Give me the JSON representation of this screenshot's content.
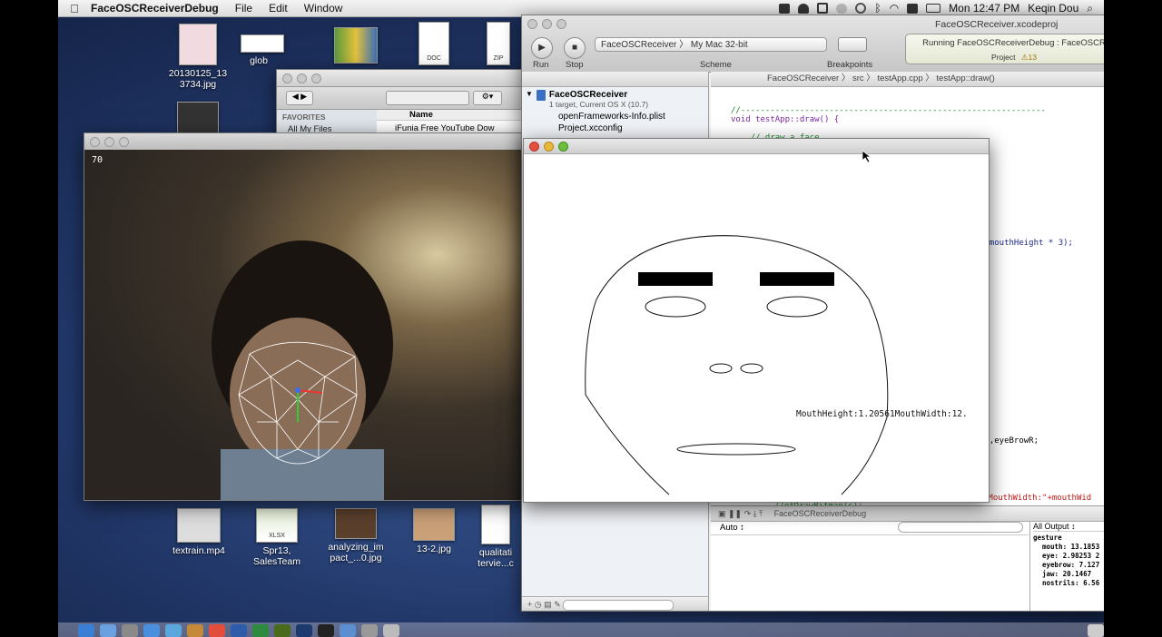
{
  "menubar": {
    "app_name": "FaceOSCReceiverDebug",
    "menus": [
      "File",
      "Edit",
      "Window"
    ],
    "clock": "Mon 12:47 PM",
    "user": "Keqin Dou"
  },
  "desktop_items": [
    {
      "label": "20130125_13\n3734.jpg"
    },
    {
      "label": "glob"
    },
    {
      "label": "textrain.mp4"
    },
    {
      "label": "Spr13,\nSalesTeam"
    },
    {
      "label": "analyzing_im\npact_...0.jpg"
    },
    {
      "label": "13-2.jpg"
    },
    {
      "label": "qualitati\ntervie...c"
    }
  ],
  "desktop_badges": {
    "doc": "DOC",
    "zip": "ZIP",
    "xlsx": "XLSX"
  },
  "camera_window": {
    "fps": "70"
  },
  "finder": {
    "sidebar_header": "FAVORITES",
    "sidebar_item": "All My Files",
    "column": "Name",
    "row": "iFunia Free YouTube Dow"
  },
  "xcode": {
    "toolbar": {
      "run": "Run",
      "stop": "Stop",
      "scheme_label": "Scheme",
      "scheme_value": "FaceOSCReceiver 〉 My Mac 32-bit",
      "breakpoints": "Breakpoints",
      "activity_status": "Running FaceOSCReceiverDebug : FaceOSCR",
      "activity_project": "Project",
      "activity_warnings": "⚠13"
    },
    "title": "FaceOSCReceiver.xcodeproj",
    "navigator": {
      "project": "FaceOSCReceiver",
      "project_sub": "1 target, Current OS X (10.7)",
      "files": [
        "openFrameworks-Info.plist",
        "Project.xcconfig"
      ]
    },
    "jumpbar": [
      "FaceOSCReceiver",
      "src",
      "testApp.cpp",
      "testApp::draw()"
    ],
    "code": {
      "comment": "//--------------------------------------------------------------",
      "line1": "void testApp::draw() {",
      "line2": "    // draw a face",
      "frag1": "e.mouthHeight * 3);",
      "frag2": ";",
      "frag3": ";",
      "frag4": "wL,eyeBrowR;",
      "frag5": "\"MouthWidth:\"+mouthWid",
      "frag6": "//ofDrawBitmap(s);"
    },
    "debug": {
      "process": "FaceOSCReceiverDebug",
      "auto": "Auto ↕",
      "all_output": "All Output ↕",
      "output_lines": [
        "gesture",
        "mouth: 13.1853",
        "eye: 2.98253 2",
        "eyebrow: 7.127",
        "jaw: 20.1467",
        "nostrils: 6.56"
      ]
    }
  },
  "face_window": {
    "overlay": "MouthHeight:1.20561MouthWidth:12."
  }
}
